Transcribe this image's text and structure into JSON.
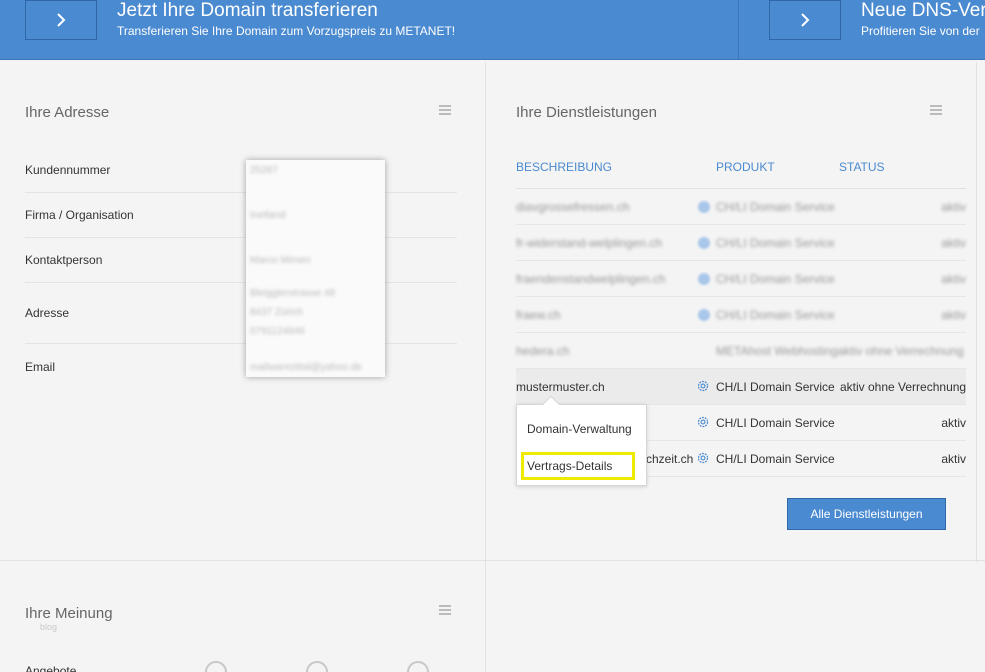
{
  "banner": {
    "left": {
      "title": "Jetzt Ihre Domain transferieren",
      "subtitle": "Transferieren Sie Ihre Domain zum Vorzugspreis zu METANET!"
    },
    "right": {
      "title": "Neue DNS-Verw",
      "subtitle": "Profitieren Sie von der"
    }
  },
  "address": {
    "title": "Ihre Adresse",
    "fields": [
      {
        "label": "Kundennummer"
      },
      {
        "label": "Firma / Organisation"
      },
      {
        "label": "Kontaktperson"
      },
      {
        "label": "Adresse"
      },
      {
        "label": "Email"
      }
    ],
    "redacted_lines": [
      "25287",
      "Inetland",
      "Marco Mimen",
      "Bleigglerstrasse 48",
      "8437 Zürich",
      "0791124846",
      "mailwarezittal@yahoo.de"
    ]
  },
  "services": {
    "title": "Ihre Dienstleistungen",
    "columns": {
      "description": "BESCHREIBUNG",
      "product": "PRODUKT",
      "status": "STATUS"
    },
    "rows": [
      {
        "name": "diavgrossefressen.ch",
        "product": "CH/LI Domain Service",
        "status": "aktiv"
      },
      {
        "name": "fr-widerstand-welplingen.ch",
        "product": "CH/LI Domain Service",
        "status": "aktiv"
      },
      {
        "name": "fraendenstandwelplingen.ch",
        "product": "CH/LI Domain Service",
        "status": "aktiv"
      },
      {
        "name": "fraew.ch",
        "product": "CH/LI Domain Service",
        "status": "aktiv"
      },
      {
        "name": "hedera.ch",
        "product": "METAhost Webhostingaktiv ohne Verrechnung",
        "status": ""
      },
      {
        "name": "mustermuster.ch",
        "product": "CH/LI Domain Service",
        "status": "aktiv ohne Verrechnung"
      },
      {
        "name": "",
        "product": "CH/LI Domain Service",
        "status": "aktiv"
      },
      {
        "name": "chzeit.ch",
        "product": "CH/LI Domain Service",
        "status": "aktiv"
      }
    ],
    "popup": {
      "items": [
        "Domain-Verwaltung",
        "Vertrags-Details"
      ]
    },
    "all_button": "Alle Dienstleistungen"
  },
  "opinion": {
    "title": "Ihre Meinung",
    "watermark": "blog",
    "row_label": "Angebote"
  }
}
